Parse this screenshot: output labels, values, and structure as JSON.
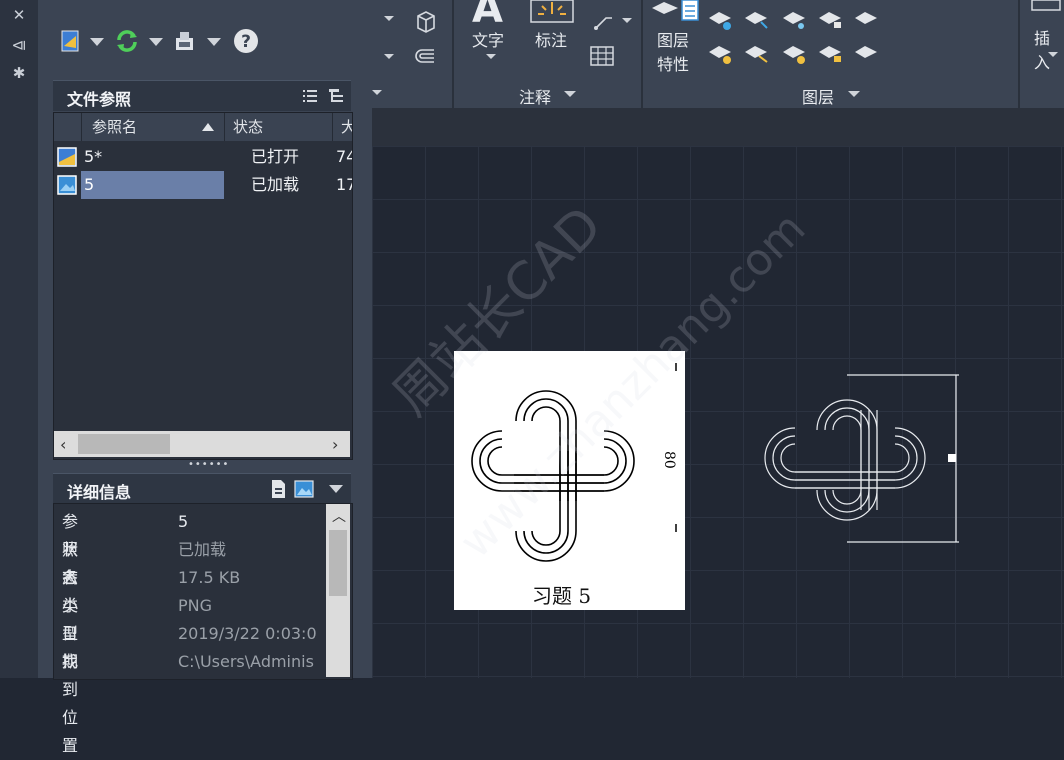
{
  "palette": {
    "xref_section_title": "文件参照",
    "columns": [
      "参照名",
      "状态",
      "大"
    ],
    "rows": [
      {
        "name": "5*",
        "status": "已打开",
        "size": "74"
      },
      {
        "name": "5",
        "status": "已加载",
        "size": "17"
      }
    ],
    "details_title": "详细信息",
    "details": [
      {
        "key": "参照名",
        "value": "5"
      },
      {
        "key": "状态",
        "value": "已加载"
      },
      {
        "key": "大小",
        "value": "17.5 KB"
      },
      {
        "key": "类型",
        "value": "PNG"
      },
      {
        "key": "日期",
        "value": "2019/3/22 0:03:0"
      },
      {
        "key": "找到位置",
        "value": "C:\\Users\\Adminis"
      }
    ]
  },
  "ribbon": {
    "text_label": "文字",
    "dimension_label": "标注",
    "annotation_label": "注释",
    "layer_props_label": "图层特性",
    "layer_props_line1": "图层",
    "layer_props_line2": "特性",
    "layers_label": "图层",
    "insert_label": "插入"
  },
  "canvas": {
    "image_caption": "习题  5",
    "image_dim_text": "80",
    "watermark1": "周站长CAD",
    "watermark2": "www.zhanzhang.com"
  },
  "colors": {
    "accent": "#6a7fa8",
    "selected_row": "#6a7fa8"
  }
}
